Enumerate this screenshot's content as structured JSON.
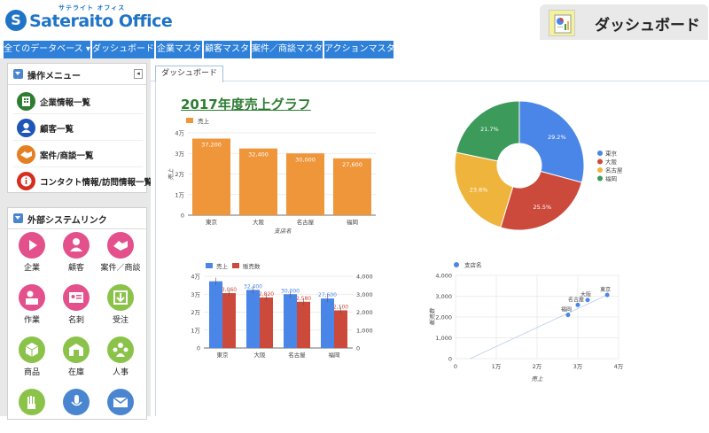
{
  "header": {
    "logo_mark": "S",
    "logo_ruby": "サテライト オフィス",
    "logo_text": "Sateraito Office",
    "page_title": "ダッシュボード"
  },
  "nav": {
    "tabs": [
      {
        "label": "全てのデータベース ▾"
      },
      {
        "label": "ダッシュボード"
      },
      {
        "label": "企業マスタ"
      },
      {
        "label": "顧客マスタ"
      },
      {
        "label": "案件／商談マスタ"
      },
      {
        "label": "アクションマスタ"
      }
    ]
  },
  "sidebar": {
    "menu_title": "操作メニュー",
    "collapse_glyph": "◂",
    "menu_items": [
      {
        "label": "企業情報一覧",
        "icon": "building-icon",
        "color": "#2e7d32"
      },
      {
        "label": "顧客一覧",
        "icon": "person-icon",
        "color": "#1e56b8"
      },
      {
        "label": "案件/商談一覧",
        "icon": "handshake-icon",
        "color": "#e67e22"
      },
      {
        "label": "コンタクト情報/訪問情報一覧",
        "icon": "info-icon",
        "color": "#d62d20"
      }
    ],
    "ext_title": "外部システムリンク",
    "ext_items": [
      {
        "label": "企業",
        "icon": "play-icon",
        "color": "#e3508c"
      },
      {
        "label": "顧客",
        "icon": "person-icon",
        "color": "#e3508c"
      },
      {
        "label": "案件／商談",
        "icon": "handshake-icon",
        "color": "#e3508c"
      },
      {
        "label": "作業",
        "icon": "worker-icon",
        "color": "#e3508c"
      },
      {
        "label": "名刺",
        "icon": "card-icon",
        "color": "#e3508c"
      },
      {
        "label": "受注",
        "icon": "download-icon",
        "color": "#8bc34a"
      },
      {
        "label": "商品",
        "icon": "box-icon",
        "color": "#8bc34a"
      },
      {
        "label": "在庫",
        "icon": "warehouse-icon",
        "color": "#8bc34a"
      },
      {
        "label": "人事",
        "icon": "people-icon",
        "color": "#8bc34a"
      },
      {
        "label": "",
        "icon": "hand-icon",
        "color": "#8bc34a"
      },
      {
        "label": "",
        "icon": "mic-icon",
        "color": "#4a86d0"
      },
      {
        "label": "",
        "icon": "mail-icon",
        "color": "#4a86d0"
      }
    ]
  },
  "main": {
    "tab_label": "ダッシュボード",
    "report_title": "2017年度売上グラフ"
  },
  "chart_data": [
    {
      "type": "bar",
      "categories": [
        "東京",
        "大阪",
        "名古屋",
        "福岡"
      ],
      "series": [
        {
          "name": "売上",
          "values": [
            37200,
            32400,
            30000,
            27600
          ],
          "color": "#f0963a"
        }
      ],
      "value_labels": [
        "37,200",
        "32,400",
        "30,000",
        "27,600"
      ],
      "ylabel": "売上",
      "xlabel": "支店名",
      "ylim": [
        0,
        40000
      ],
      "yticks": [
        "0",
        "1万",
        "2万",
        "3万",
        "4万"
      ]
    },
    {
      "type": "pie",
      "donut": true,
      "slices": [
        {
          "label": "東京",
          "value": 29.2,
          "color": "#4a86e8"
        },
        {
          "label": "大阪",
          "value": 25.5,
          "color": "#cc4a3b"
        },
        {
          "label": "名古屋",
          "value": 23.6,
          "color": "#efb43c"
        },
        {
          "label": "福岡",
          "value": 21.7,
          "color": "#3c9a5b"
        }
      ],
      "legend": "right"
    },
    {
      "type": "bar",
      "categories": [
        "東京",
        "大阪",
        "名古屋",
        "福岡"
      ],
      "series": [
        {
          "name": "売上",
          "values": [
            37200,
            32400,
            30000,
            27600
          ],
          "labels": [
            "",
            "32,400",
            "30,000",
            "27,600"
          ],
          "color": "#4a86e8",
          "axis": "left"
        },
        {
          "name": "販売数",
          "values": [
            3060,
            2820,
            2580,
            2100
          ],
          "labels": [
            "3,060",
            "2,820",
            "2,580",
            "2,100"
          ],
          "color": "#cc4a3b",
          "axis": "right"
        }
      ],
      "ylim_left": [
        0,
        40000
      ],
      "yticks_left": [
        "0",
        "1万",
        "2万",
        "3万",
        "4万"
      ],
      "ylim_right": [
        0,
        4000
      ],
      "yticks_right": [
        "0",
        "1,000",
        "2,000",
        "3,000",
        "4,000"
      ],
      "error_bars": true
    },
    {
      "type": "scatter",
      "series": [
        {
          "name": "支店名",
          "color": "#4a86e8"
        }
      ],
      "points": [
        {
          "label": "東京",
          "x": 37200,
          "y": 3060
        },
        {
          "label": "大阪",
          "x": 32400,
          "y": 2820
        },
        {
          "label": "名古屋",
          "x": 30000,
          "y": 2580
        },
        {
          "label": "福岡",
          "x": 27600,
          "y": 2100
        }
      ],
      "trendline": true,
      "xlabel": "売上",
      "ylabel": "販売数",
      "xlim": [
        0,
        40000
      ],
      "xticks": [
        "0",
        "1万",
        "2万",
        "3万",
        "4万"
      ],
      "ylim": [
        0,
        4000
      ],
      "yticks": [
        "0",
        "1,000",
        "2,000",
        "3,000",
        "4,000"
      ]
    }
  ]
}
